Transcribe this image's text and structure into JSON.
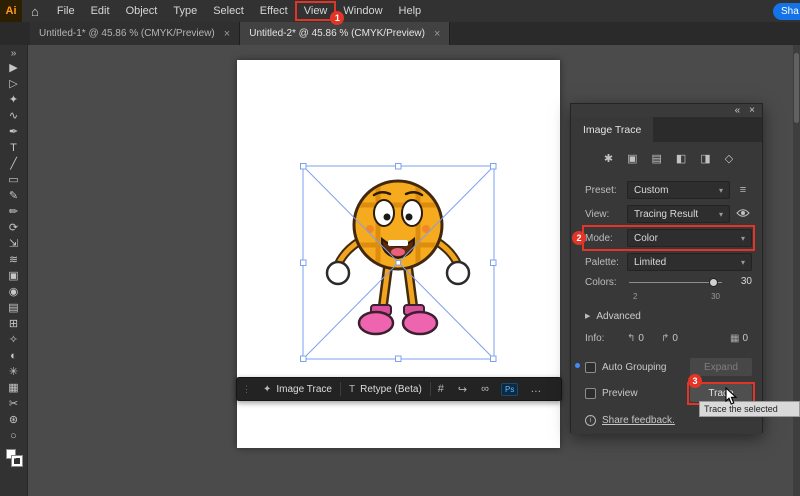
{
  "colors": {
    "annotation": "#e23528",
    "share_button": "#1473e6",
    "selection": "#7da0f0"
  },
  "menu_bar": {
    "logo": "Ai",
    "home_icon": "⌂",
    "items": [
      "File",
      "Edit",
      "Object",
      "Type",
      "Select",
      "Effect",
      "View",
      "Window",
      "Help"
    ],
    "share_label": "Sha"
  },
  "tabs": [
    {
      "label": "Untitled-1* @ 45.86 % (CMYK/Preview)",
      "close": "×"
    },
    {
      "label": "Untitled-2* @ 45.86 % (CMYK/Preview)",
      "close": "×"
    }
  ],
  "toolbar": {
    "expand": "»",
    "tools": [
      {
        "name": "selection",
        "glyph": "▶"
      },
      {
        "name": "direct-selection",
        "glyph": "▷"
      },
      {
        "name": "magic-wand",
        "glyph": "✦"
      },
      {
        "name": "lasso",
        "glyph": "∿"
      },
      {
        "name": "pen",
        "glyph": "✒"
      },
      {
        "name": "type",
        "glyph": "T"
      },
      {
        "name": "line-segment",
        "glyph": "╱"
      },
      {
        "name": "rectangle",
        "glyph": "▭"
      },
      {
        "name": "paintbrush",
        "glyph": "✎"
      },
      {
        "name": "pencil",
        "glyph": "✏"
      },
      {
        "name": "rotate",
        "glyph": "⟳"
      },
      {
        "name": "scale",
        "glyph": "⇲"
      },
      {
        "name": "width",
        "glyph": "≋"
      },
      {
        "name": "free-transform",
        "glyph": "▣"
      },
      {
        "name": "shape-builder",
        "glyph": "◉"
      },
      {
        "name": "gradient",
        "glyph": "▤"
      },
      {
        "name": "mesh",
        "glyph": "⊞"
      },
      {
        "name": "eyedropper",
        "glyph": "✧"
      },
      {
        "name": "blend",
        "glyph": "◐"
      },
      {
        "name": "symbol-sprayer",
        "glyph": "✳"
      },
      {
        "name": "column-graph",
        "glyph": "▦"
      },
      {
        "name": "slice",
        "glyph": "✂"
      },
      {
        "name": "hand",
        "glyph": "⊛"
      },
      {
        "name": "zoom",
        "glyph": "○"
      }
    ]
  },
  "context_bar": {
    "grip": "⋮",
    "image_trace_icon": "✦",
    "image_trace_label": "Image Trace",
    "retype_icon": "T",
    "retype_label": "Retype (Beta)",
    "crop_icon": "#",
    "export_icon": "↪",
    "link_icon": "∞",
    "ps_badge": "Ps",
    "more_icon": "…"
  },
  "panel": {
    "collapse_icon": "«",
    "close_icon": "×",
    "title": "Image Trace",
    "preset_icons": [
      {
        "name": "auto-color",
        "glyph": "✱"
      },
      {
        "name": "high-color",
        "glyph": "▣"
      },
      {
        "name": "low-color",
        "glyph": "▤"
      },
      {
        "name": "grayscale",
        "glyph": "◧"
      },
      {
        "name": "black-and-white",
        "glyph": "◨"
      },
      {
        "name": "outline",
        "glyph": "◇"
      }
    ],
    "preset_label": "Preset:",
    "preset_value": "Custom",
    "menu_icon": "≡",
    "view_label": "View:",
    "view_value": "Tracing Result",
    "mode_label": "Mode:",
    "mode_value": "Color",
    "palette_label": "Palette:",
    "palette_value": "Limited",
    "colors_label": "Colors:",
    "colors_value": "30",
    "colors_min": "2",
    "colors_max": "30",
    "advanced_arrow": "▶",
    "advanced_label": "Advanced",
    "info_label": "Info:",
    "info_items": [
      {
        "name": "paths-count",
        "icon": "↰",
        "value": "0"
      },
      {
        "name": "anchors-count",
        "icon": "↱",
        "value": "0"
      },
      {
        "name": "colors-count",
        "icon": "▦",
        "value": "0"
      }
    ],
    "auto_grouping_label": "Auto Grouping",
    "expand_button": "Expand",
    "preview_label": "Preview",
    "trace_button": "Trace",
    "feedback_icon": "i",
    "feedback_label": "Share feedback."
  },
  "annotations": {
    "step1": "1",
    "step2": "2",
    "step3": "3",
    "tooltip": "Trace the selected"
  },
  "ui": {
    "chevron": "▾"
  }
}
